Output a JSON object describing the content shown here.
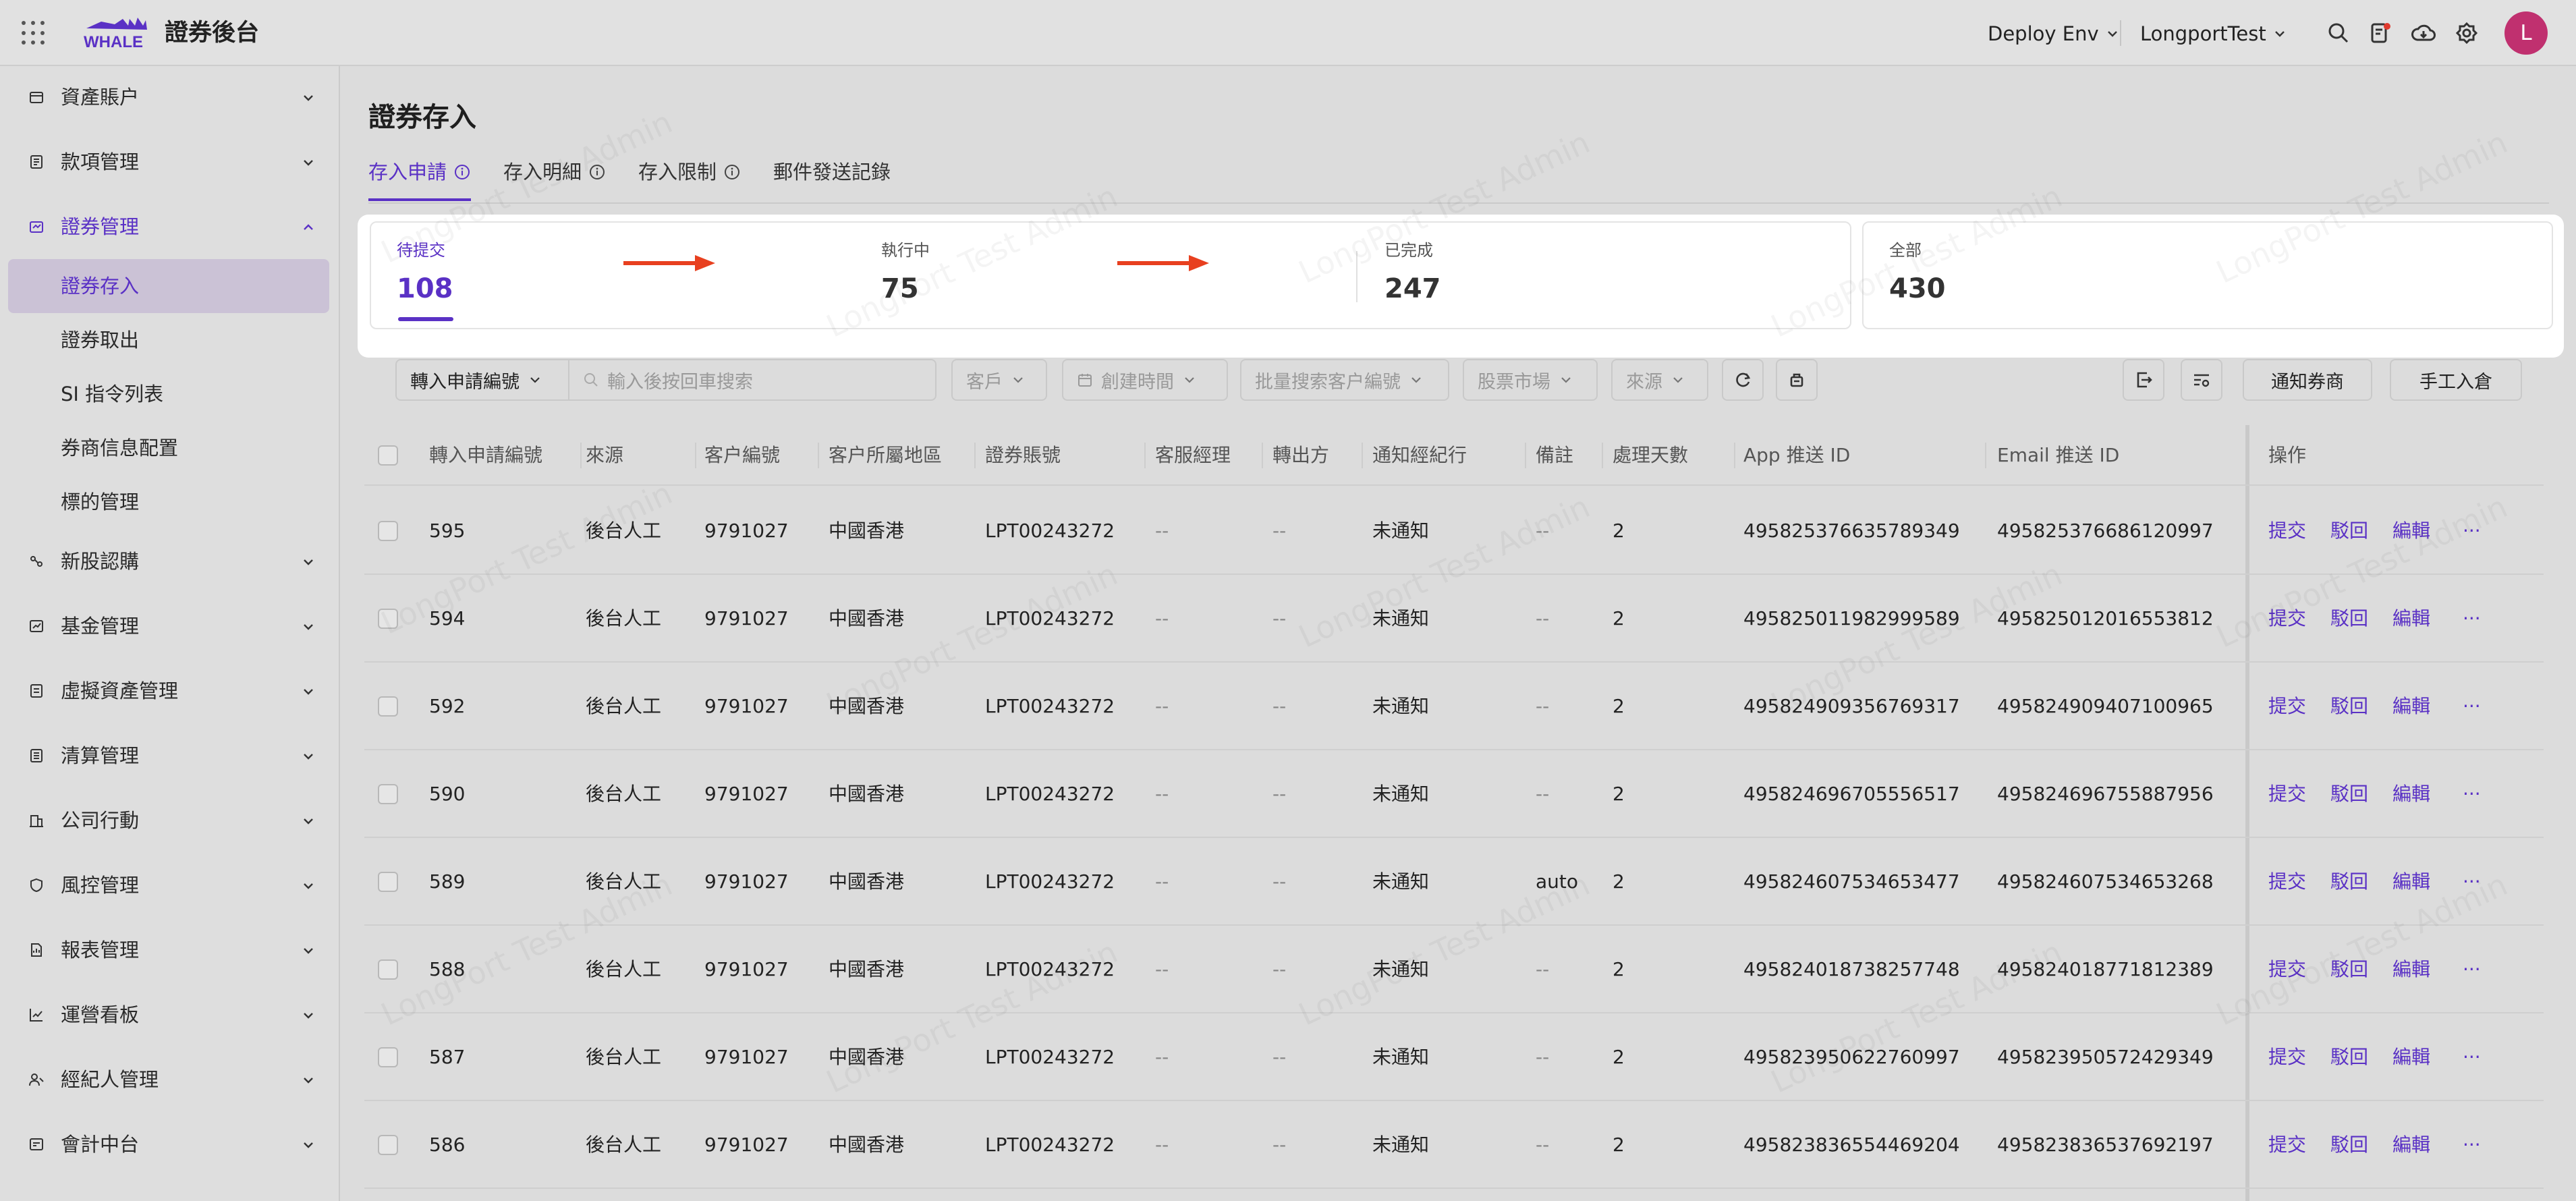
{
  "app": {
    "title": "證券後台",
    "logo_text": "WHALE",
    "env": "Deploy Env",
    "tenant": "LongportTest",
    "avatar": "L"
  },
  "sidebar": {
    "items": [
      {
        "label": "資產賬户"
      },
      {
        "label": "款項管理"
      },
      {
        "label": "證券管理"
      },
      {
        "label": "新股認購"
      },
      {
        "label": "基金管理"
      },
      {
        "label": "虛擬資產管理"
      },
      {
        "label": "清算管理"
      },
      {
        "label": "公司行動"
      },
      {
        "label": "風控管理"
      },
      {
        "label": "報表管理"
      },
      {
        "label": "運營看板"
      },
      {
        "label": "經紀人管理"
      },
      {
        "label": "會計中台"
      }
    ],
    "sub_items": [
      {
        "label": "證券存入"
      },
      {
        "label": "證券取出"
      },
      {
        "label": "SI 指令列表"
      },
      {
        "label": "券商信息配置"
      },
      {
        "label": "標的管理"
      }
    ]
  },
  "page": {
    "title": "證券存入",
    "tabs": [
      {
        "label": "存入申請"
      },
      {
        "label": "存入明細"
      },
      {
        "label": "存入限制"
      },
      {
        "label": "郵件發送記錄"
      }
    ]
  },
  "stats": [
    {
      "label": "待提交",
      "value": "108"
    },
    {
      "label": "執行中",
      "value": "75"
    },
    {
      "label": "已完成",
      "value": "247"
    },
    {
      "label": "全部",
      "value": "430"
    }
  ],
  "filters": {
    "id_select": "轉入申請編號",
    "search_placeholder": "輸入後按回車搜索",
    "customer": "客戶",
    "created_time": "創建時間",
    "batch_search": "批量搜索客户編號",
    "market": "股票市場",
    "source": "來源",
    "notify_broker": "通知券商",
    "manual_in": "手工入倉"
  },
  "table": {
    "headers": [
      "轉入申請編號",
      "來源",
      "客户編號",
      "客户所屬地區",
      "證券賬號",
      "客服經理",
      "轉出方",
      "通知經紀行",
      "備註",
      "處理天數",
      "App 推送 ID",
      "Email 推送 ID",
      "操作"
    ],
    "rows": [
      [
        "595",
        "後台人工",
        "9791027",
        "中國香港",
        "LPT00243272",
        "--",
        "--",
        "未通知",
        "--",
        "2",
        "495825376635789349",
        "495825376686120997"
      ],
      [
        "594",
        "後台人工",
        "9791027",
        "中國香港",
        "LPT00243272",
        "--",
        "--",
        "未通知",
        "--",
        "2",
        "495825011982999589",
        "495825012016553812"
      ],
      [
        "592",
        "後台人工",
        "9791027",
        "中國香港",
        "LPT00243272",
        "--",
        "--",
        "未通知",
        "--",
        "2",
        "495824909356769317",
        "495824909407100965"
      ],
      [
        "590",
        "後台人工",
        "9791027",
        "中國香港",
        "LPT00243272",
        "--",
        "--",
        "未通知",
        "--",
        "2",
        "495824696705556517",
        "495824696755887956"
      ],
      [
        "589",
        "後台人工",
        "9791027",
        "中國香港",
        "LPT00243272",
        "--",
        "--",
        "未通知",
        "auto",
        "2",
        "495824607534653477",
        "495824607534653268"
      ],
      [
        "588",
        "後台人工",
        "9791027",
        "中國香港",
        "LPT00243272",
        "--",
        "--",
        "未通知",
        "--",
        "2",
        "495824018738257748",
        "495824018771812389"
      ],
      [
        "587",
        "後台人工",
        "9791027",
        "中國香港",
        "LPT00243272",
        "--",
        "--",
        "未通知",
        "--",
        "2",
        "495823950622760997",
        "495823950572429349"
      ],
      [
        "586",
        "後台人工",
        "9791027",
        "中國香港",
        "LPT00243272",
        "--",
        "--",
        "未通知",
        "--",
        "2",
        "495823836554469204",
        "495823836537692197"
      ]
    ],
    "actions": {
      "submit": "提交",
      "reject": "駁回",
      "edit": "編輯",
      "more": "···"
    }
  },
  "watermark": "LongPort Test Admin",
  "colors": {
    "accent": "#5a31c5",
    "avatar": "#c0306f",
    "arrow": "#e8401f"
  }
}
